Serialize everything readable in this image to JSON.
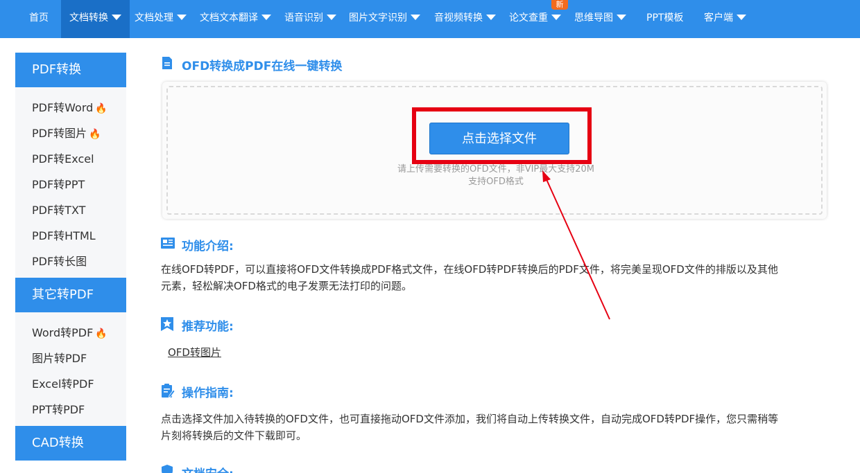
{
  "nav": {
    "items": [
      {
        "label": "首页",
        "dropdown": false
      },
      {
        "label": "文档转换",
        "dropdown": true,
        "active": true
      },
      {
        "label": "文档处理",
        "dropdown": true
      },
      {
        "label": "文档文本翻译",
        "dropdown": true
      },
      {
        "label": "语音识别",
        "dropdown": true
      },
      {
        "label": "图片文字识别",
        "dropdown": true
      },
      {
        "label": "音视频转换",
        "dropdown": true
      },
      {
        "label": "论文查重",
        "dropdown": true
      },
      {
        "label": "思维导图",
        "dropdown": true
      },
      {
        "label": "PPT模板",
        "dropdown": false
      },
      {
        "label": "客户端",
        "dropdown": true
      }
    ],
    "new_badge": "新"
  },
  "sidebar": {
    "groups": [
      {
        "title": "PDF转换",
        "items": [
          {
            "label": "PDF转Word",
            "hot": true
          },
          {
            "label": "PDF转图片",
            "hot": true
          },
          {
            "label": "PDF转Excel",
            "hot": false
          },
          {
            "label": "PDF转PPT",
            "hot": false
          },
          {
            "label": "PDF转TXT",
            "hot": false
          },
          {
            "label": "PDF转HTML",
            "hot": false
          },
          {
            "label": "PDF转长图",
            "hot": false
          }
        ]
      },
      {
        "title": "其它转PDF",
        "items": [
          {
            "label": "Word转PDF",
            "hot": true
          },
          {
            "label": "图片转PDF",
            "hot": false
          },
          {
            "label": "Excel转PDF",
            "hot": false
          },
          {
            "label": "PPT转PDF",
            "hot": false
          }
        ]
      },
      {
        "title": "CAD转换",
        "items": []
      }
    ]
  },
  "main": {
    "title": "OFD转换成PDF在线一键转换",
    "upload": {
      "button": "点击选择文件",
      "hint_line1": "请上传需要转换的OFD文件，非VIP最大支持20M",
      "hint_line2": "支持OFD格式"
    },
    "intro": {
      "title": "功能介绍:",
      "text_line1": "在线OFD转PDF，可以直接将OFD文件转换成PDF格式文件，在线OFD转PDF转换后的PDF文件，将完美呈现OFD文件的排版以及其他",
      "text_line2": "元素，轻松解决OFD格式的电子发票无法打印的问题。"
    },
    "recommend": {
      "title": "推荐功能:",
      "link": "OFD转图片"
    },
    "guide": {
      "title": "操作指南:",
      "text_line1": "点击选择文件加入待转换的OFD文件，也可直接拖动OFD文件添加，我们将自动上传转换文件，自动完成OFD转PDF操作，您只需稍等",
      "text_line2": "片刻将转换后的文件下载即可。"
    },
    "security": {
      "title": "文档安全:"
    }
  },
  "colors": {
    "brand": "#2f8eea",
    "nav_active": "#1a6fc7",
    "annotation_red": "#e60012",
    "hot": "#f5712b"
  }
}
